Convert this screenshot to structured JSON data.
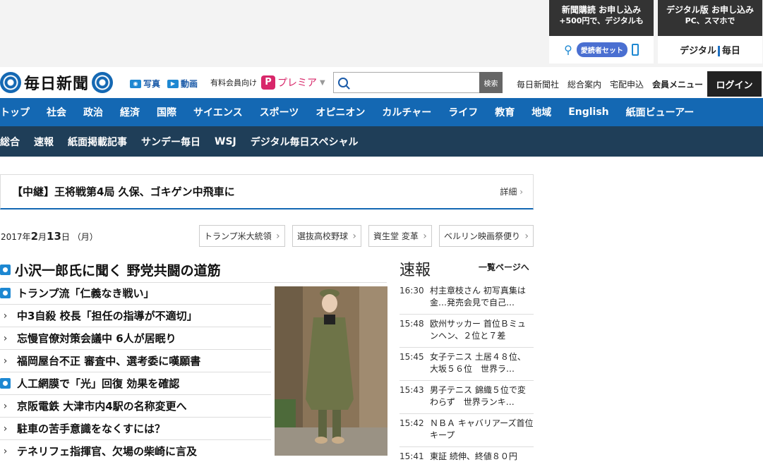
{
  "promos": [
    {
      "line1": "新聞購読 お申し込み",
      "line2": "+500円で、デジタルも",
      "button": "愛読者セット"
    },
    {
      "line1": "デジタル版 お申し込み",
      "line2": "PC、スマホで",
      "logo_main": "デジタル",
      "logo_accent": "毎日"
    }
  ],
  "header": {
    "logo_text": "毎日新聞",
    "photo_link": "写真",
    "video_link": "動画",
    "premier_prefix": "有料会員向け",
    "premier_badge": "P",
    "premier_name": "プレミア",
    "search_placeholder": "",
    "search_button": "検索",
    "links": [
      "毎日新聞社",
      "総合案内",
      "宅配申込",
      "会員メニュー"
    ],
    "login": "ログイン"
  },
  "main_nav": [
    "トップ",
    "社会",
    "政治",
    "経済",
    "国際",
    "サイエンス",
    "スポーツ",
    "オピニオン",
    "カルチャー",
    "ライフ",
    "教育",
    "地域",
    "English",
    "紙面ビューアー"
  ],
  "sub_nav": [
    "総合",
    "速報",
    "紙面掲載記事",
    "サンデー毎日",
    "WSJ",
    "デジタル毎日スペシャル"
  ],
  "live_banner": {
    "text": "【中継】王将戦第4局 久保、ゴキゲン中飛車に",
    "more": "詳細"
  },
  "date": {
    "year": "2017",
    "y_unit": "年",
    "month": "2",
    "m_unit": "月",
    "day": "13",
    "d_unit": "日",
    "weekday": "（月）"
  },
  "topics": [
    "トランプ米大統領",
    "選抜高校野球",
    "資生堂 変革",
    "ベルリン映画祭便り"
  ],
  "top_headline": "小沢一郎氏に聞く 野党共闘の道筋",
  "headlines": [
    {
      "text": "トランプ流「仁義なき戦い」",
      "mark": "premier"
    },
    {
      "text": "中3自殺 校長「担任の指導が不適切」",
      "mark": "chevron"
    },
    {
      "text": "忘慢官僚対策会議中 6人が居眠り",
      "mark": "chevron"
    },
    {
      "text": "福岡屋台不正 審査中、選考委に嘆願書",
      "mark": "chevron"
    },
    {
      "text": "人工網膜で「光」回復 効果を確認",
      "mark": "premier"
    },
    {
      "text": "京阪電鉄 大津市内4駅の名称変更へ",
      "mark": "chevron"
    },
    {
      "text": "駐車の苦手意識をなくすには？",
      "mark": "chevron"
    },
    {
      "text": "テネリフェ指揮官、欠場の柴崎に言及",
      "mark": "chevron"
    }
  ],
  "breaking": {
    "title": "速報",
    "more": "一覧ページへ",
    "items": [
      {
        "time": "16:30",
        "text": "村主章枝さん 初写真集は金…発売会見で自己…"
      },
      {
        "time": "15:48",
        "text": "欧州サッカー 首位Ｂミュンヘン、２位と７差"
      },
      {
        "time": "15:45",
        "text": "女子テニス 土居４８位、大坂５６位　世界ラ…"
      },
      {
        "time": "15:43",
        "text": "男子テニス 錦織５位で変わらず　世界ランキ…"
      },
      {
        "time": "15:42",
        "text": "ＮＢＡ キャバリアーズ首位キープ"
      },
      {
        "time": "15:41",
        "text": "東証 続伸、終値８０円"
      }
    ]
  }
}
